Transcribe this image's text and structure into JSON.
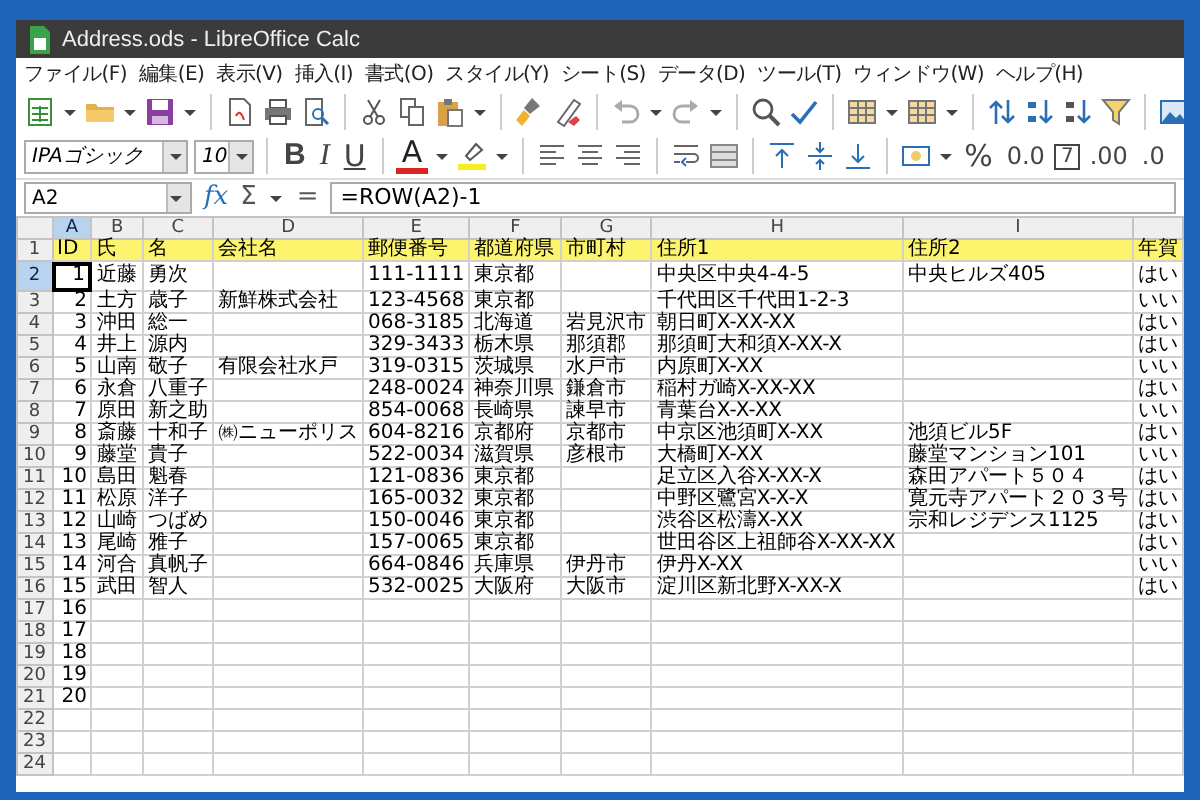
{
  "window": {
    "title": "Address.ods - LibreOffice Calc"
  },
  "menu": [
    "ファイル(F)",
    "編集(E)",
    "表示(V)",
    "挿入(I)",
    "書式(O)",
    "スタイル(Y)",
    "シート(S)",
    "データ(D)",
    "ツール(T)",
    "ウィンドウ(W)",
    "ヘルプ(H)"
  ],
  "format_toolbar": {
    "font_name": "IPAゴシック",
    "font_size": "10",
    "bold": "B",
    "italic": "I",
    "underline": "U",
    "font_color": "A",
    "percent": "%",
    "decimal": "0.0",
    "date": "7",
    "add_decimal": ".00",
    "delete_decimal": ".0"
  },
  "formula_bar": {
    "name_box": "A2",
    "buttons": [
      "fx",
      "Σ",
      "="
    ],
    "formula": "=ROW(A2)-1"
  },
  "sheet": {
    "columns": [
      {
        "label": "A",
        "selected": true
      },
      {
        "label": "B",
        "selected": false
      },
      {
        "label": "C",
        "selected": false
      },
      {
        "label": "D",
        "selected": false
      },
      {
        "label": "E",
        "selected": false
      },
      {
        "label": "F",
        "selected": false
      },
      {
        "label": "G",
        "selected": false
      },
      {
        "label": "H",
        "selected": false
      },
      {
        "label": "I",
        "selected": false
      },
      {
        "selected": false
      }
    ],
    "rows": [
      {
        "number": "1",
        "kind": "header",
        "selected": false,
        "cells": [
          "ID",
          "氏",
          "名",
          "会社名",
          "郵便番号",
          "都道府県",
          "市町村",
          "住所1",
          "住所2",
          "年賀"
        ]
      },
      {
        "number": "2",
        "kind": "data",
        "selected": true,
        "cells": [
          "1",
          "近藤",
          "勇次",
          null,
          "111-1111",
          "東京都",
          null,
          "中央区中央4-4-5",
          "中央ヒルズ405",
          "はい"
        ]
      },
      {
        "number": "3",
        "kind": "data",
        "selected": false,
        "cells": [
          "2",
          "土方",
          "歳子",
          "新鮮株式会社",
          "123-4568",
          "東京都",
          null,
          "千代田区千代田1-2-3",
          null,
          "いい"
        ]
      },
      {
        "number": "4",
        "kind": "data",
        "selected": false,
        "cells": [
          "3",
          "沖田",
          "総一",
          null,
          "068-3185",
          "北海道",
          "岩見沢市",
          "朝日町X-XX-XX",
          null,
          "はい"
        ]
      },
      {
        "number": "5",
        "kind": "data",
        "selected": false,
        "cells": [
          "4",
          "井上",
          "源内",
          null,
          "329-3433",
          "栃木県",
          "那須郡",
          "那須町大和須X-XX-X",
          null,
          "はい"
        ]
      },
      {
        "number": "6",
        "kind": "data",
        "selected": false,
        "cells": [
          "5",
          "山南",
          "敬子",
          "有限会社水戸",
          "319-0315",
          "茨城県",
          "水戸市",
          "内原町X-XX",
          null,
          "いい"
        ]
      },
      {
        "number": "7",
        "kind": "data",
        "selected": false,
        "cells": [
          "6",
          "永倉",
          "八重子",
          null,
          "248-0024",
          "神奈川県",
          "鎌倉市",
          "稲村ガ崎X-XX-XX",
          null,
          "はい"
        ]
      },
      {
        "number": "8",
        "kind": "data",
        "selected": false,
        "cells": [
          "7",
          "原田",
          "新之助",
          null,
          "854-0068",
          "長崎県",
          "諫早市",
          "青葉台X-X-XX",
          null,
          "いい"
        ]
      },
      {
        "number": "9",
        "kind": "data",
        "selected": false,
        "cells": [
          "8",
          "斎藤",
          "十和子",
          "㈱ニューポリス",
          "604-8216",
          "京都府",
          "京都市",
          "中京区池須町X-XX",
          "池須ビル5F",
          "はい"
        ]
      },
      {
        "number": "10",
        "kind": "data",
        "selected": false,
        "cells": [
          "9",
          "藤堂",
          "貴子",
          null,
          "522-0034",
          "滋賀県",
          "彦根市",
          "大橋町X-XX",
          "藤堂マンション101",
          "いい"
        ]
      },
      {
        "number": "11",
        "kind": "data",
        "selected": false,
        "cells": [
          "10",
          "島田",
          "魁春",
          null,
          "121-0836",
          "東京都",
          null,
          "足立区入谷X-XX-X",
          "森田アパート５０４",
          "はい"
        ]
      },
      {
        "number": "12",
        "kind": "data",
        "selected": false,
        "cells": [
          "11",
          "松原",
          "洋子",
          null,
          "165-0032",
          "東京都",
          null,
          "中野区鷺宮X-X-X",
          "寛元寺アパート２０３号",
          "はい"
        ]
      },
      {
        "number": "13",
        "kind": "data",
        "selected": false,
        "cells": [
          "12",
          "山崎",
          "つばめ",
          null,
          "150-0046",
          "東京都",
          null,
          "渋谷区松濤X-XX",
          "宗和レジデンス1125",
          "はい"
        ]
      },
      {
        "number": "14",
        "kind": "data",
        "selected": false,
        "cells": [
          "13",
          "尾崎",
          "雅子",
          null,
          "157-0065",
          "東京都",
          null,
          "世田谷区上祖師谷X-XX-XX",
          null,
          "はい"
        ]
      },
      {
        "number": "15",
        "kind": "data",
        "selected": false,
        "cells": [
          "14",
          "河合",
          "真帆子",
          null,
          "664-0846",
          "兵庫県",
          "伊丹市",
          "伊丹X-XX",
          null,
          "いい"
        ]
      },
      {
        "number": "16",
        "kind": "data",
        "selected": false,
        "cells": [
          "15",
          "武田",
          "智人",
          null,
          "532-0025",
          "大阪府",
          "大阪市",
          "淀川区新北野X-XX-X",
          null,
          "はい"
        ]
      },
      {
        "number": "17",
        "kind": "data",
        "selected": false,
        "cells": [
          "16"
        ]
      },
      {
        "number": "18",
        "kind": "data",
        "selected": false,
        "cells": [
          "17"
        ]
      },
      {
        "number": "19",
        "kind": "data",
        "selected": false,
        "cells": [
          "18"
        ]
      },
      {
        "number": "20",
        "kind": "data",
        "selected": false,
        "cells": [
          "19"
        ]
      },
      {
        "number": "21",
        "kind": "data",
        "selected": false,
        "cells": [
          "20"
        ]
      },
      {
        "number": "22",
        "kind": "data",
        "selected": false,
        "cells": []
      },
      {
        "number": "23",
        "kind": "data",
        "selected": false,
        "cells": []
      },
      {
        "number": "24",
        "kind": "data",
        "selected": false,
        "cells": []
      }
    ]
  }
}
